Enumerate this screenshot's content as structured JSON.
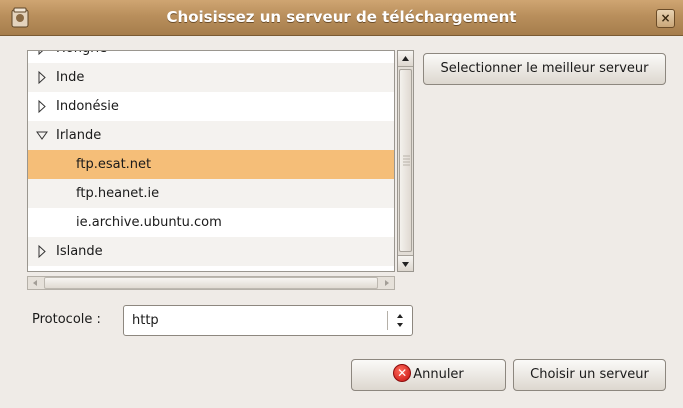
{
  "window": {
    "title": "Choisissez un serveur de téléchargement",
    "close_label": "×"
  },
  "tree": {
    "partial_row": "Hongrie",
    "rows": [
      {
        "label": "Inde",
        "level": 0,
        "expander": "collapsed"
      },
      {
        "label": "Indonésie",
        "level": 0,
        "expander": "collapsed"
      },
      {
        "label": "Irlande",
        "level": 0,
        "expander": "expanded"
      },
      {
        "label": "ftp.esat.net",
        "level": 1,
        "selected": true
      },
      {
        "label": "ftp.heanet.ie",
        "level": 1
      },
      {
        "label": "ie.archive.ubuntu.com",
        "level": 1
      },
      {
        "label": "Islande",
        "level": 0,
        "expander": "collapsed"
      }
    ]
  },
  "buttons": {
    "best_server": "Selectionner le meilleur serveur",
    "cancel": "Annuler",
    "choose": "Choisir un serveur"
  },
  "protocol": {
    "label": "Protocole :",
    "value": "http"
  },
  "colors": {
    "titlebar": "#b98f5c",
    "selection": "#f5be78",
    "cancel_icon": "#d81b1b"
  }
}
